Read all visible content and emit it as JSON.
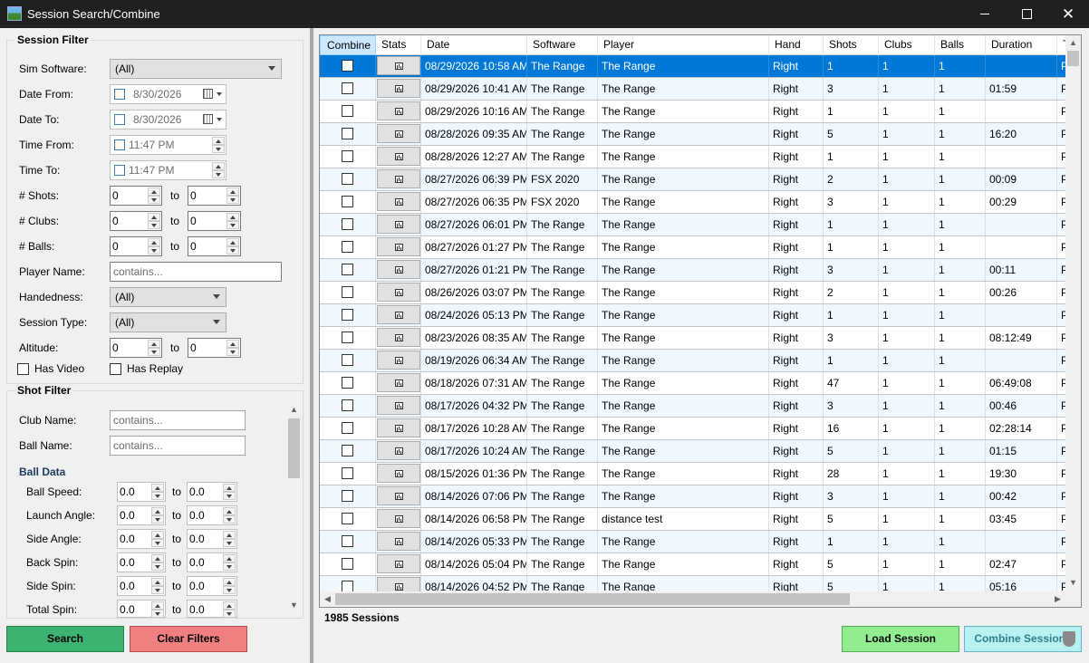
{
  "window": {
    "title": "Session Search/Combine",
    "minimize_glyph": "",
    "maximize_glyph": "",
    "close_glyph": "✕"
  },
  "session_filter": {
    "title": "Session Filter",
    "sim_software": {
      "label": "Sim Software:",
      "value": "(All)"
    },
    "date_from": {
      "label": "Date From:",
      "value": "8/30/2026"
    },
    "date_to": {
      "label": "Date To:",
      "value": "8/30/2026"
    },
    "time_from": {
      "label": "Time From:",
      "value": "11:47 PM"
    },
    "time_to": {
      "label": "Time To:",
      "value": "11:47 PM"
    },
    "shots": {
      "label": "# Shots:",
      "from": "0",
      "to": "0"
    },
    "clubs": {
      "label": "# Clubs:",
      "from": "0",
      "to": "0"
    },
    "balls": {
      "label": "# Balls:",
      "from": "0",
      "to": "0"
    },
    "player_name": {
      "label": "Player Name:",
      "placeholder": "contains..."
    },
    "handedness": {
      "label": "Handedness:",
      "value": "(All)"
    },
    "session_type": {
      "label": "Session Type:",
      "value": "(All)"
    },
    "altitude": {
      "label": "Altitude:",
      "from": "0",
      "to": "0"
    },
    "has_video": {
      "label": "Has Video",
      "checked": false
    },
    "has_replay": {
      "label": "Has Replay",
      "checked": false
    },
    "to_label": "to"
  },
  "shot_filter": {
    "title": "Shot Filter",
    "club_name": {
      "label": "Club Name:",
      "placeholder": "contains..."
    },
    "ball_name": {
      "label": "Ball Name:",
      "placeholder": "contains..."
    },
    "ball_data_heading": "Ball Data",
    "ball_speed": {
      "label": "Ball Speed:",
      "from": "0.0",
      "to": "0.0"
    },
    "launch_angle": {
      "label": "Launch Angle:",
      "from": "0.0",
      "to": "0.0"
    },
    "side_angle": {
      "label": "Side Angle:",
      "from": "0.0",
      "to": "0.0"
    },
    "back_spin": {
      "label": "Back Spin:",
      "from": "0.0",
      "to": "0.0"
    },
    "side_spin": {
      "label": "Side Spin:",
      "from": "0.0",
      "to": "0.0"
    },
    "total_spin": {
      "label": "Total Spin:",
      "from": "0.0",
      "to": "0.0"
    }
  },
  "buttons": {
    "search": "Search",
    "clear_filters": "Clear Filters",
    "load_session": "Load Session",
    "combine_sessions": "Combine Sessions"
  },
  "grid": {
    "columns": [
      "Combine",
      "Stats",
      "Date",
      "Software",
      "Player",
      "Hand",
      "Shots",
      "Clubs",
      "Balls",
      "Duration",
      "T"
    ],
    "rows": [
      {
        "date": "08/29/2026 10:58 AM",
        "software": "The Range",
        "player": "The Range",
        "hand": "Right",
        "shots": "1",
        "clubs": "1",
        "balls": "1",
        "duration": "",
        "type": "Pr",
        "selected": true
      },
      {
        "date": "08/29/2026 10:41 AM",
        "software": "The Range",
        "player": "The Range",
        "hand": "Right",
        "shots": "3",
        "clubs": "1",
        "balls": "1",
        "duration": "01:59",
        "type": "Pr"
      },
      {
        "date": "08/29/2026 10:16 AM",
        "software": "The Range",
        "player": "The Range",
        "hand": "Right",
        "shots": "1",
        "clubs": "1",
        "balls": "1",
        "duration": "",
        "type": "Pr"
      },
      {
        "date": "08/28/2026 09:35 AM",
        "software": "The Range",
        "player": "The Range",
        "hand": "Right",
        "shots": "5",
        "clubs": "1",
        "balls": "1",
        "duration": "16:20",
        "type": "Pr"
      },
      {
        "date": "08/28/2026 12:27 AM",
        "software": "The Range",
        "player": "The Range",
        "hand": "Right",
        "shots": "1",
        "clubs": "1",
        "balls": "1",
        "duration": "",
        "type": "Pr"
      },
      {
        "date": "08/27/2026 06:39 PM",
        "software": "FSX 2020",
        "player": "The Range",
        "hand": "Right",
        "shots": "2",
        "clubs": "1",
        "balls": "1",
        "duration": "00:09",
        "type": "Pr"
      },
      {
        "date": "08/27/2026 06:35 PM",
        "software": "FSX 2020",
        "player": "The Range",
        "hand": "Right",
        "shots": "3",
        "clubs": "1",
        "balls": "1",
        "duration": "00:29",
        "type": "Pr"
      },
      {
        "date": "08/27/2026 06:01 PM",
        "software": "The Range",
        "player": "The Range",
        "hand": "Right",
        "shots": "1",
        "clubs": "1",
        "balls": "1",
        "duration": "",
        "type": "Pr"
      },
      {
        "date": "08/27/2026 01:27 PM",
        "software": "The Range",
        "player": "The Range",
        "hand": "Right",
        "shots": "1",
        "clubs": "1",
        "balls": "1",
        "duration": "",
        "type": "Pr"
      },
      {
        "date": "08/27/2026 01:21 PM",
        "software": "The Range",
        "player": "The Range",
        "hand": "Right",
        "shots": "3",
        "clubs": "1",
        "balls": "1",
        "duration": "00:11",
        "type": "Pr"
      },
      {
        "date": "08/26/2026 03:07 PM",
        "software": "The Range",
        "player": "The Range",
        "hand": "Right",
        "shots": "2",
        "clubs": "1",
        "balls": "1",
        "duration": "00:26",
        "type": "Pr"
      },
      {
        "date": "08/24/2026 05:13 PM",
        "software": "The Range",
        "player": "The Range",
        "hand": "Right",
        "shots": "1",
        "clubs": "1",
        "balls": "1",
        "duration": "",
        "type": "Pr"
      },
      {
        "date": "08/23/2026 08:35 AM",
        "software": "The Range",
        "player": "The Range",
        "hand": "Right",
        "shots": "3",
        "clubs": "1",
        "balls": "1",
        "duration": "08:12:49",
        "type": "Pr"
      },
      {
        "date": "08/19/2026 06:34 AM",
        "software": "The Range",
        "player": "The Range",
        "hand": "Right",
        "shots": "1",
        "clubs": "1",
        "balls": "1",
        "duration": "",
        "type": "Pr"
      },
      {
        "date": "08/18/2026 07:31 AM",
        "software": "The Range",
        "player": "The Range",
        "hand": "Right",
        "shots": "47",
        "clubs": "1",
        "balls": "1",
        "duration": "06:49:08",
        "type": "Pr"
      },
      {
        "date": "08/17/2026 04:32 PM",
        "software": "The Range",
        "player": "The Range",
        "hand": "Right",
        "shots": "3",
        "clubs": "1",
        "balls": "1",
        "duration": "00:46",
        "type": "Pr"
      },
      {
        "date": "08/17/2026 10:28 AM",
        "software": "The Range",
        "player": "The Range",
        "hand": "Right",
        "shots": "16",
        "clubs": "1",
        "balls": "1",
        "duration": "02:28:14",
        "type": "Pr"
      },
      {
        "date": "08/17/2026 10:24 AM",
        "software": "The Range",
        "player": "The Range",
        "hand": "Right",
        "shots": "5",
        "clubs": "1",
        "balls": "1",
        "duration": "01:15",
        "type": "Pr"
      },
      {
        "date": "08/15/2026 01:36 PM",
        "software": "The Range",
        "player": "The Range",
        "hand": "Right",
        "shots": "28",
        "clubs": "1",
        "balls": "1",
        "duration": "19:30",
        "type": "Pr"
      },
      {
        "date": "08/14/2026 07:06 PM",
        "software": "The Range",
        "player": "The Range",
        "hand": "Right",
        "shots": "3",
        "clubs": "1",
        "balls": "1",
        "duration": "00:42",
        "type": "Pr"
      },
      {
        "date": "08/14/2026 06:58 PM",
        "software": "The Range",
        "player": "distance test",
        "hand": "Right",
        "shots": "5",
        "clubs": "1",
        "balls": "1",
        "duration": "03:45",
        "type": "Pr"
      },
      {
        "date": "08/14/2026 05:33 PM",
        "software": "The Range",
        "player": "The Range",
        "hand": "Right",
        "shots": "1",
        "clubs": "1",
        "balls": "1",
        "duration": "",
        "type": "Pr"
      },
      {
        "date": "08/14/2026 05:04 PM",
        "software": "The Range",
        "player": "The Range",
        "hand": "Right",
        "shots": "5",
        "clubs": "1",
        "balls": "1",
        "duration": "02:47",
        "type": "Pr"
      },
      {
        "date": "08/14/2026 04:52 PM",
        "software": "The Range",
        "player": "The Range",
        "hand": "Right",
        "shots": "5",
        "clubs": "1",
        "balls": "1",
        "duration": "05:16",
        "type": "Pr"
      }
    ]
  },
  "status": {
    "session_count": "1985 Sessions"
  },
  "colors": {
    "search": "#3cb371",
    "clear_filters": "#f08080",
    "load_session": "#90ee90",
    "combine_sessions": "#b8f1f1",
    "selected_row": "#0078d7",
    "alt_row": "#f0f8ff",
    "title_bar": "#202020"
  },
  "icons": {
    "app": "app-logo-icon",
    "stats": "bar-chart-icon",
    "combine": "shield-icon"
  }
}
